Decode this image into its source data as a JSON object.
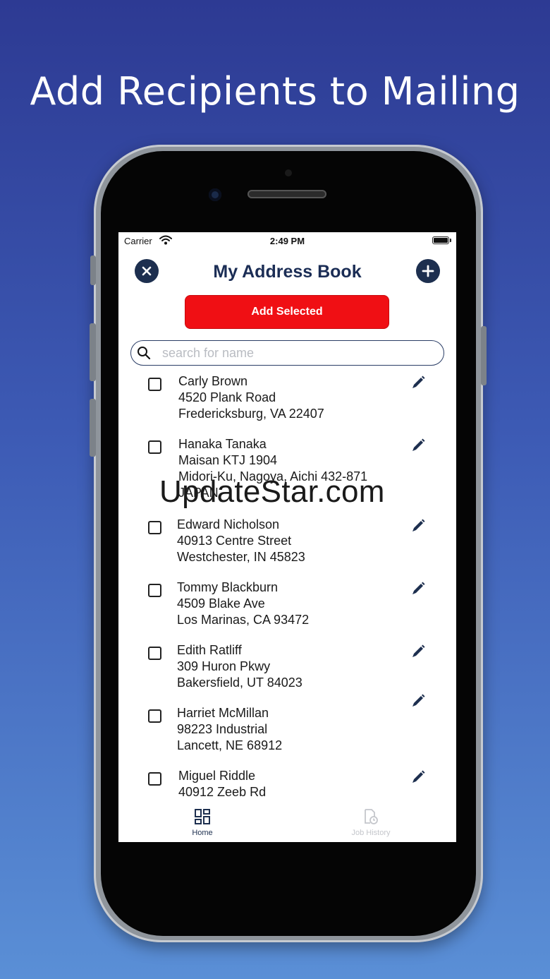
{
  "headline": "Add Recipients to Mailing",
  "status": {
    "carrier": "Carrier",
    "time": "2:49 PM"
  },
  "header": {
    "title": "My Address Book",
    "add_selected_label": "Add Selected"
  },
  "search": {
    "placeholder": "search for name",
    "value": ""
  },
  "contacts": [
    {
      "name": "Carly Brown",
      "line1": "4520 Plank Road",
      "line2": "Fredericksburg, VA  22407",
      "line3": ""
    },
    {
      "name": "Hanaka Tanaka",
      "line1": "Maisan KTJ 1904",
      "line2": "Midori-Ku, Nagoya, Aichi 432-871",
      "line3": "JAPAN"
    },
    {
      "name": "Edward Nicholson",
      "line1": "40913 Centre Street",
      "line2": "Westchester, IN 45823",
      "line3": ""
    },
    {
      "name": "Tommy Blackburn",
      "line1": "4509 Blake Ave",
      "line2": "Los Marinas, CA 93472",
      "line3": ""
    },
    {
      "name": "Edith Ratliff",
      "line1": "309 Huron Pkwy",
      "line2": "Bakersfield, UT  84023",
      "line3": ""
    },
    {
      "name": "Harriet McMillan",
      "line1": "98223 Industrial",
      "line2": "Lancett, NE 68912",
      "line3": ""
    },
    {
      "name": "Miguel Riddle",
      "line1": "40912 Zeeb Rd",
      "line2": "",
      "line3": ""
    }
  ],
  "watermark": "UpdateStar.com",
  "tabs": {
    "home": {
      "label": "Home",
      "color": "#1d2f4f"
    },
    "history": {
      "label": "Job History",
      "color": "#c4c6cb"
    }
  },
  "colors": {
    "accent": "#1d2f4f",
    "button_red": "#f00f14",
    "title": "#1b2d55"
  },
  "icons": [
    "close-icon",
    "plus-icon",
    "search-icon",
    "edit-pencil-icon",
    "grid-icon",
    "document-clock-icon",
    "wifi-icon",
    "battery-icon"
  ]
}
